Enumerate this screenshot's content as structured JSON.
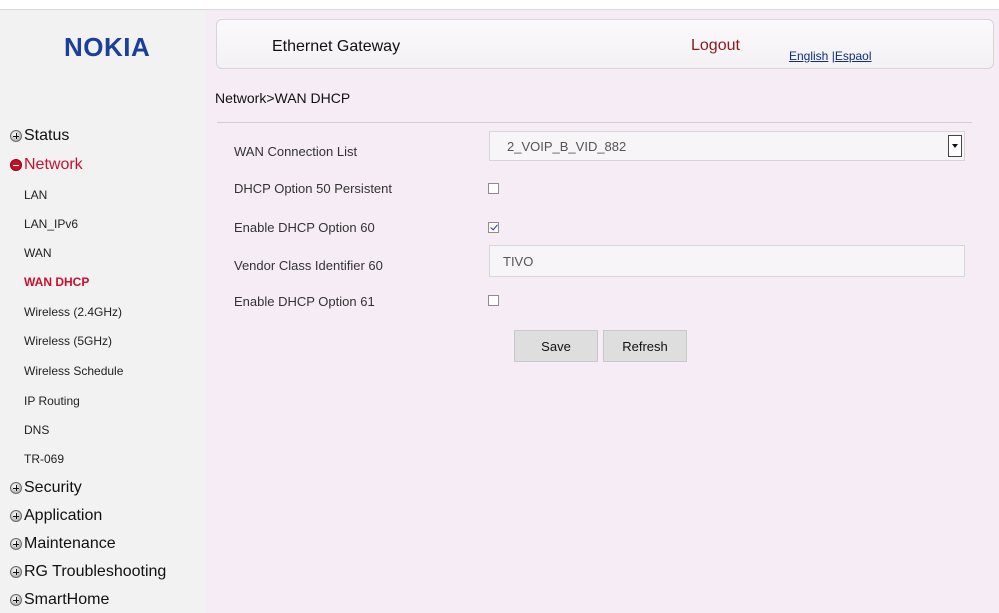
{
  "brand": {
    "logo_text": "NOKIA",
    "logo_color": "#1a3f9c"
  },
  "header": {
    "title": "Ethernet Gateway",
    "logout": "Logout",
    "lang_english": "English",
    "lang_separator": " |",
    "lang_spanish": "Espaol"
  },
  "breadcrumb": "Network>WAN DHCP",
  "sidebar": {
    "status": "Status",
    "network": "Network",
    "network_items": [
      "LAN",
      "LAN_IPv6",
      "WAN",
      "WAN DHCP",
      "Wireless (2.4GHz)",
      "Wireless (5GHz)",
      "Wireless Schedule",
      "IP Routing",
      "DNS",
      "TR-069"
    ],
    "security": "Security",
    "application": "Application",
    "maintenance": "Maintenance",
    "rg_troubleshooting": "RG Troubleshooting",
    "smarthome": "SmartHome"
  },
  "form": {
    "wan_connection_list": {
      "label": "WAN Connection List",
      "value": "2_VOIP_B_VID_882"
    },
    "dhcp_option_50": {
      "label": "DHCP Option 50 Persistent",
      "checked": false
    },
    "dhcp_option_60": {
      "label": "Enable DHCP Option 60",
      "checked": true
    },
    "vendor_class_60": {
      "label": "Vendor Class Identifier 60",
      "value": "TIVO"
    },
    "dhcp_option_61": {
      "label": "Enable DHCP Option 61",
      "checked": false
    }
  },
  "buttons": {
    "save": "Save",
    "refresh": "Refresh"
  },
  "colors": {
    "accent_red": "#c8102e",
    "main_bg": "#f6ecf6",
    "sidebar_bg": "#f2f2f2"
  }
}
